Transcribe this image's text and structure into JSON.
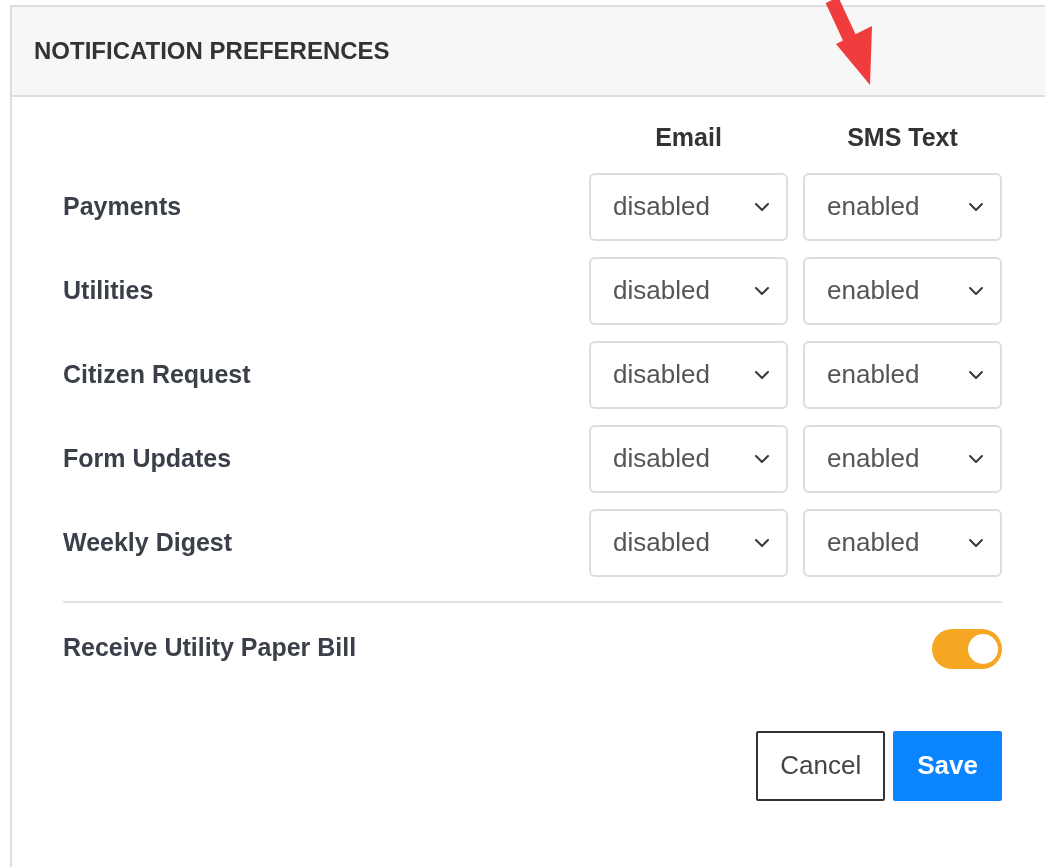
{
  "card": {
    "title": "NOTIFICATION PREFERENCES"
  },
  "columns": [
    "Email",
    "SMS Text"
  ],
  "rows": [
    {
      "label": "Payments",
      "email": "disabled",
      "sms": "enabled"
    },
    {
      "label": "Utilities",
      "email": "disabled",
      "sms": "enabled"
    },
    {
      "label": "Citizen Request",
      "email": "disabled",
      "sms": "enabled"
    },
    {
      "label": "Form Updates",
      "email": "disabled",
      "sms": "enabled"
    },
    {
      "label": "Weekly Digest",
      "email": "disabled",
      "sms": "enabled"
    }
  ],
  "paper_bill": {
    "label": "Receive Utility Paper Bill",
    "on": true
  },
  "buttons": [
    {
      "label": "Cancel",
      "kind": "secondary"
    },
    {
      "label": "Save",
      "kind": "primary"
    }
  ]
}
